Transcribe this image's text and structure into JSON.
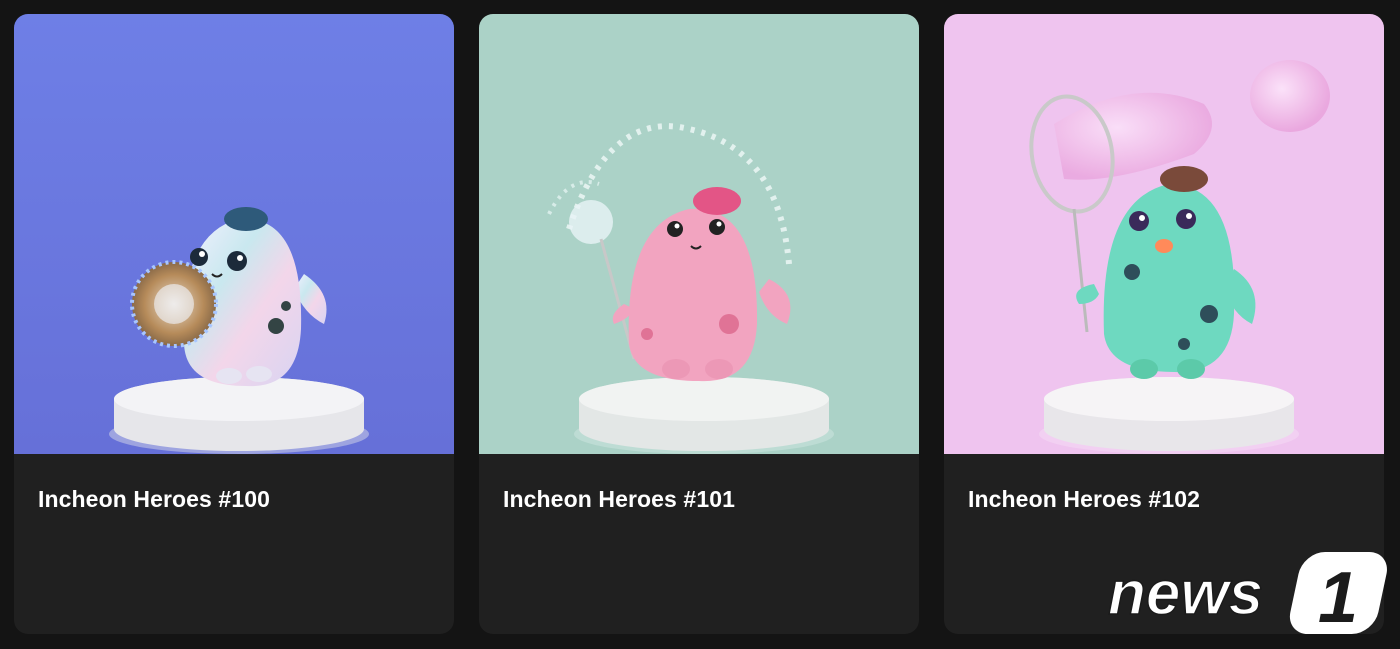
{
  "cards": [
    {
      "title": "Incheon Heroes #100",
      "background": "#717fe0",
      "character_color": "#dcd9ec",
      "prop": "shield"
    },
    {
      "title": "Incheon Heroes #101",
      "background": "#abd2c7",
      "character_color": "#f2a4c0",
      "prop": "water-wand"
    },
    {
      "title": "Incheon Heroes #102",
      "background": "#efc4ef",
      "character_color": "#6ed9c0",
      "prop": "bubble-net"
    }
  ],
  "watermark": {
    "text": "news",
    "mark": "1"
  }
}
